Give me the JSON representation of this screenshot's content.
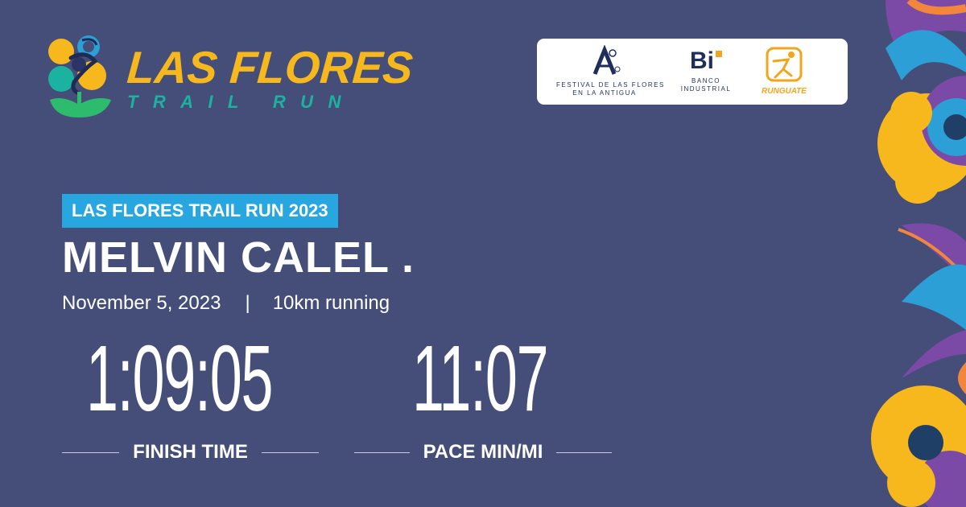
{
  "logo": {
    "title": "LAS FLORES",
    "subtitle": "TRAIL RUN",
    "mark_icon": "flower-runner-logo-icon"
  },
  "sponsors": {
    "festival": {
      "icon": "festival-flores-logo-icon",
      "line1": "FESTIVAL DE LAS FLORES",
      "line2": "EN LA ANTIGUA"
    },
    "banco": {
      "icon": "banco-industrial-logo-icon",
      "mark": "Bi",
      "line1": "BANCO",
      "line2": "INDUSTRIAL"
    },
    "runguate": {
      "icon": "runguate-logo-icon",
      "label": "RUNGUATE"
    }
  },
  "race": {
    "badge": "LAS FLORES TRAIL RUN 2023",
    "runner_name": "MELVIN CALEL .",
    "date": "November 5, 2023",
    "separator": "|",
    "category": "10km running"
  },
  "stats": {
    "finish_time": {
      "value": "1:09:05",
      "label": "FINISH TIME"
    },
    "pace": {
      "value": "11:07",
      "label": "PACE MIN/MI"
    }
  },
  "colors": {
    "background": "#444e78",
    "accent_yellow": "#f6b81d",
    "accent_teal": "#1bb3a0",
    "badge_blue": "#27a6e0",
    "flower_purple": "#7b4aa6",
    "flower_blue": "#2c9fd6"
  }
}
